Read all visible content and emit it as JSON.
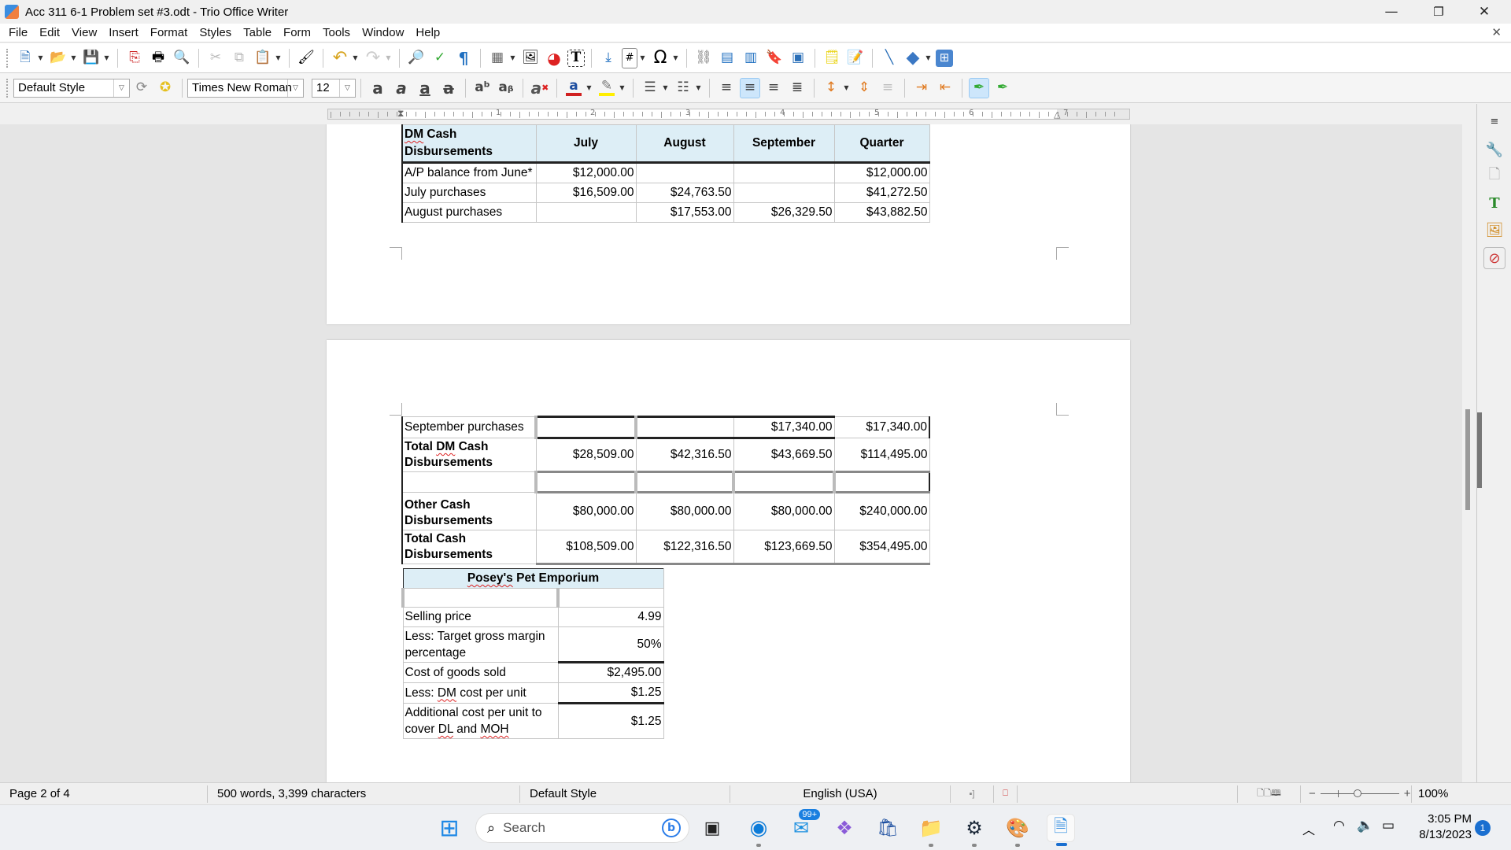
{
  "window": {
    "title": "Acc 311 6-1 Problem set #3.odt - Trio Office Writer",
    "controls": {
      "minimize": "—",
      "restore": "❐",
      "close": "✕"
    },
    "doc_close": "✕"
  },
  "menu": [
    "File",
    "Edit",
    "View",
    "Insert",
    "Format",
    "Styles",
    "Table",
    "Form",
    "Tools",
    "Window",
    "Help"
  ],
  "toolbar_standard": [
    {
      "name": "new-document-icon",
      "glyph": "🗎"
    },
    {
      "name": "open-icon",
      "glyph": "📂"
    },
    {
      "name": "save-icon",
      "glyph": "💾"
    },
    {
      "name": "export-pdf-icon",
      "glyph": "⎘"
    },
    {
      "name": "print-icon",
      "glyph": "🖶"
    },
    {
      "name": "print-preview-icon",
      "glyph": "🔍"
    },
    {
      "name": "cut-icon",
      "glyph": "✂"
    },
    {
      "name": "copy-icon",
      "glyph": "⧉"
    },
    {
      "name": "paste-icon",
      "glyph": "📋"
    },
    {
      "name": "clone-formatting-icon",
      "glyph": "🖌"
    },
    {
      "name": "undo-icon",
      "glyph": "↶"
    },
    {
      "name": "redo-icon",
      "glyph": "↷"
    },
    {
      "name": "find-replace-icon",
      "glyph": "🔎"
    },
    {
      "name": "spellcheck-icon",
      "glyph": "✓"
    },
    {
      "name": "formatting-marks-icon",
      "glyph": "¶"
    },
    {
      "name": "insert-table-icon",
      "glyph": "▦"
    },
    {
      "name": "insert-image-icon",
      "glyph": "🖼"
    },
    {
      "name": "insert-chart-icon",
      "glyph": "◕"
    },
    {
      "name": "insert-textbox-icon",
      "glyph": "T"
    },
    {
      "name": "insert-page-break-icon",
      "glyph": "⤓"
    },
    {
      "name": "insert-field-icon",
      "glyph": "#"
    },
    {
      "name": "special-character-icon",
      "glyph": "Ω"
    },
    {
      "name": "hyperlink-icon",
      "glyph": "⛓"
    },
    {
      "name": "footnote-icon",
      "glyph": "▤"
    },
    {
      "name": "endnote-icon",
      "glyph": "▥"
    },
    {
      "name": "bookmark-icon",
      "glyph": "🔖"
    },
    {
      "name": "cross-reference-icon",
      "glyph": "▣"
    },
    {
      "name": "comment-icon",
      "glyph": "🗒"
    },
    {
      "name": "track-changes-icon",
      "glyph": "📝"
    },
    {
      "name": "line-icon",
      "glyph": "╲"
    },
    {
      "name": "basic-shapes-icon",
      "glyph": "◆"
    },
    {
      "name": "draw-functions-icon",
      "glyph": "⊞"
    }
  ],
  "formatting": {
    "paragraph_style": "Default Style",
    "font_name": "Times New Roman",
    "font_size": "12",
    "font_color": "#d02020",
    "highlight_color": "#ffee00"
  },
  "ruler": {
    "numbers": [
      "1",
      "2",
      "3",
      "4",
      "5",
      "6",
      "7"
    ]
  },
  "page1_table": {
    "headers": [
      "DM Cash Disbursements",
      "July",
      "August",
      "September",
      "Quarter"
    ],
    "rows": [
      [
        "A/P balance from June*",
        "$12,000.00",
        "",
        "",
        "$12,000.00"
      ],
      [
        "July purchases",
        "$16,509.00",
        "$24,763.50",
        "",
        "$41,272.50"
      ],
      [
        "August purchases",
        "",
        "$17,553.00",
        "$26,329.50",
        "$43,882.50"
      ]
    ]
  },
  "page2_table": {
    "rows": [
      {
        "label": "September purchases",
        "values": [
          "",
          "",
          "$17,340.00",
          "$17,340.00"
        ],
        "bold": false
      },
      {
        "label": "Total DM Cash Disbursements",
        "values": [
          "$28,509.00",
          "$42,316.50",
          "$43,669.50",
          "$114,495.00"
        ],
        "bold": true
      },
      {
        "label": "",
        "values": [
          "",
          "",
          "",
          ""
        ],
        "bold": false
      },
      {
        "label": "Other Cash Disbursements",
        "values": [
          "$80,000.00",
          "$80,000.00",
          "$80,000.00",
          "$240,000.00"
        ],
        "bold": true
      },
      {
        "label": "Total Cash Disbursements",
        "values": [
          "$108,509.00",
          "$122,316.50",
          "$123,669.50",
          "$354,495.00"
        ],
        "bold": true
      }
    ]
  },
  "posey_table": {
    "title": "Posey's Pet Emporium",
    "rows": [
      [
        "",
        ""
      ],
      [
        "Selling price",
        "4.99"
      ],
      [
        "Less: Target gross margin percentage",
        "50%"
      ],
      [
        "Cost of goods sold",
        "$2,495.00"
      ],
      [
        "Less: DM cost per unit",
        "$1.25"
      ],
      [
        "Additional cost per unit to cover DL and MOH",
        "$1.25"
      ]
    ]
  },
  "statusbar": {
    "page": "Page 2 of 4",
    "words": "500 words, 3,399 characters",
    "page_style": "Default Style",
    "language": "English (USA)",
    "zoom_minus": "−",
    "zoom_plus": "+",
    "zoom": "100%",
    "zoom_level_percent": 100
  },
  "taskbar": {
    "search_placeholder": "Search",
    "mail_badge": "99+",
    "time": "3:05 PM",
    "date": "8/13/2023",
    "notification_count": "1"
  }
}
